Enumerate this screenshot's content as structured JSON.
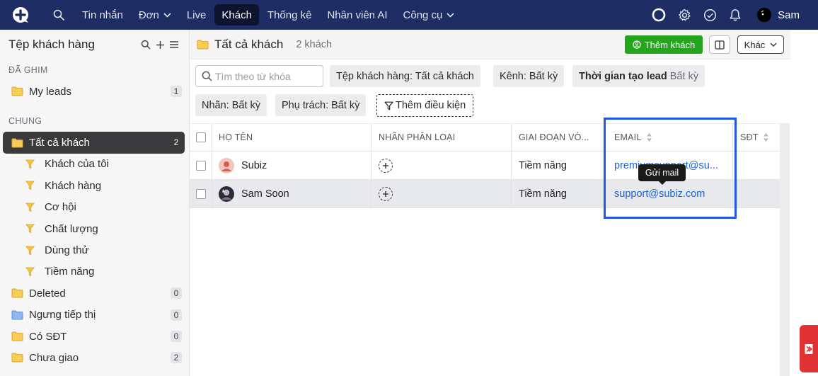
{
  "nav": {
    "items": [
      {
        "label": "Tin nhắn",
        "has_chevron": false,
        "active": false
      },
      {
        "label": "Đơn",
        "has_chevron": true,
        "active": false
      },
      {
        "label": "Live",
        "has_chevron": false,
        "active": false
      },
      {
        "label": "Khách",
        "has_chevron": false,
        "active": true
      },
      {
        "label": "Thống kê",
        "has_chevron": false,
        "active": false
      },
      {
        "label": "Nhân viên AI",
        "has_chevron": false,
        "active": false
      },
      {
        "label": "Công cụ",
        "has_chevron": true,
        "active": false
      }
    ],
    "user_name": "Sam",
    "icons": [
      "logo-icon",
      "search-icon",
      "status-ring-icon",
      "settings-icon",
      "check-circle-icon",
      "bell-icon"
    ]
  },
  "sidebar": {
    "title": "Tệp khách hàng",
    "sections": {
      "pinned": "ĐÃ GHIM",
      "general": "CHUNG"
    },
    "pinned_items": [
      {
        "label": "My leads",
        "count": "1",
        "icon": "folder-icon"
      }
    ],
    "items": [
      {
        "label": "Tất cả khách",
        "count": "2",
        "icon": "folder-icon",
        "active": true
      },
      {
        "label": "Khách của tôi",
        "count": "",
        "icon": "filter-icon"
      },
      {
        "label": "Khách hàng",
        "count": "",
        "icon": "filter-icon"
      },
      {
        "label": "Cơ hội",
        "count": "",
        "icon": "filter-icon"
      },
      {
        "label": "Chất lượng",
        "count": "",
        "icon": "filter-icon"
      },
      {
        "label": "Dùng thử",
        "count": "",
        "icon": "filter-icon"
      },
      {
        "label": "Tiềm năng",
        "count": "",
        "icon": "filter-icon"
      },
      {
        "label": "Deleted",
        "count": "0",
        "icon": "folder-icon"
      },
      {
        "label": "Ngưng tiếp thị",
        "count": "0",
        "icon": "folder-blue-icon"
      },
      {
        "label": "Có SĐT",
        "count": "0",
        "icon": "folder-icon"
      },
      {
        "label": "Chưa giao",
        "count": "2",
        "icon": "folder-icon"
      }
    ]
  },
  "main": {
    "title": "Tất cả khách",
    "subtitle": "2 khách",
    "add_button": "Thêm khách",
    "more_button": "Khác",
    "search_placeholder": "Tìm theo từ khóa",
    "filters": {
      "segment": "Tệp khách hàng: Tất cả khách",
      "channel": "Kênh: Bất kỳ",
      "lead_time_label": "Thời gian tạo lead",
      "lead_time_value": "Bất kỳ",
      "label": "Nhãn: Bất kỳ",
      "owner": "Phụ trách: Bất kỳ",
      "add_condition": "Thêm điều kiện"
    },
    "table": {
      "headers": [
        "HỌ TÊN",
        "NHÃN PHÂN LOẠI",
        "GIAI ĐOẠN VÒ...",
        "EMAIL",
        "SĐT"
      ],
      "rows": [
        {
          "name": "Subiz",
          "stage": "Tiềm năng",
          "email": "premiumsupport@su...",
          "phone": ""
        },
        {
          "name": "Sam Soon",
          "stage": "Tiềm năng",
          "email": "support@subiz.com",
          "phone": ""
        }
      ]
    },
    "tooltip": "Gửi mail"
  },
  "colors": {
    "nav_bg": "#1e2d63",
    "accent_green": "#25a51e",
    "link_blue": "#1a63d6",
    "highlight_blue": "#1f57e8",
    "folder_yellow": "#f5c542"
  }
}
